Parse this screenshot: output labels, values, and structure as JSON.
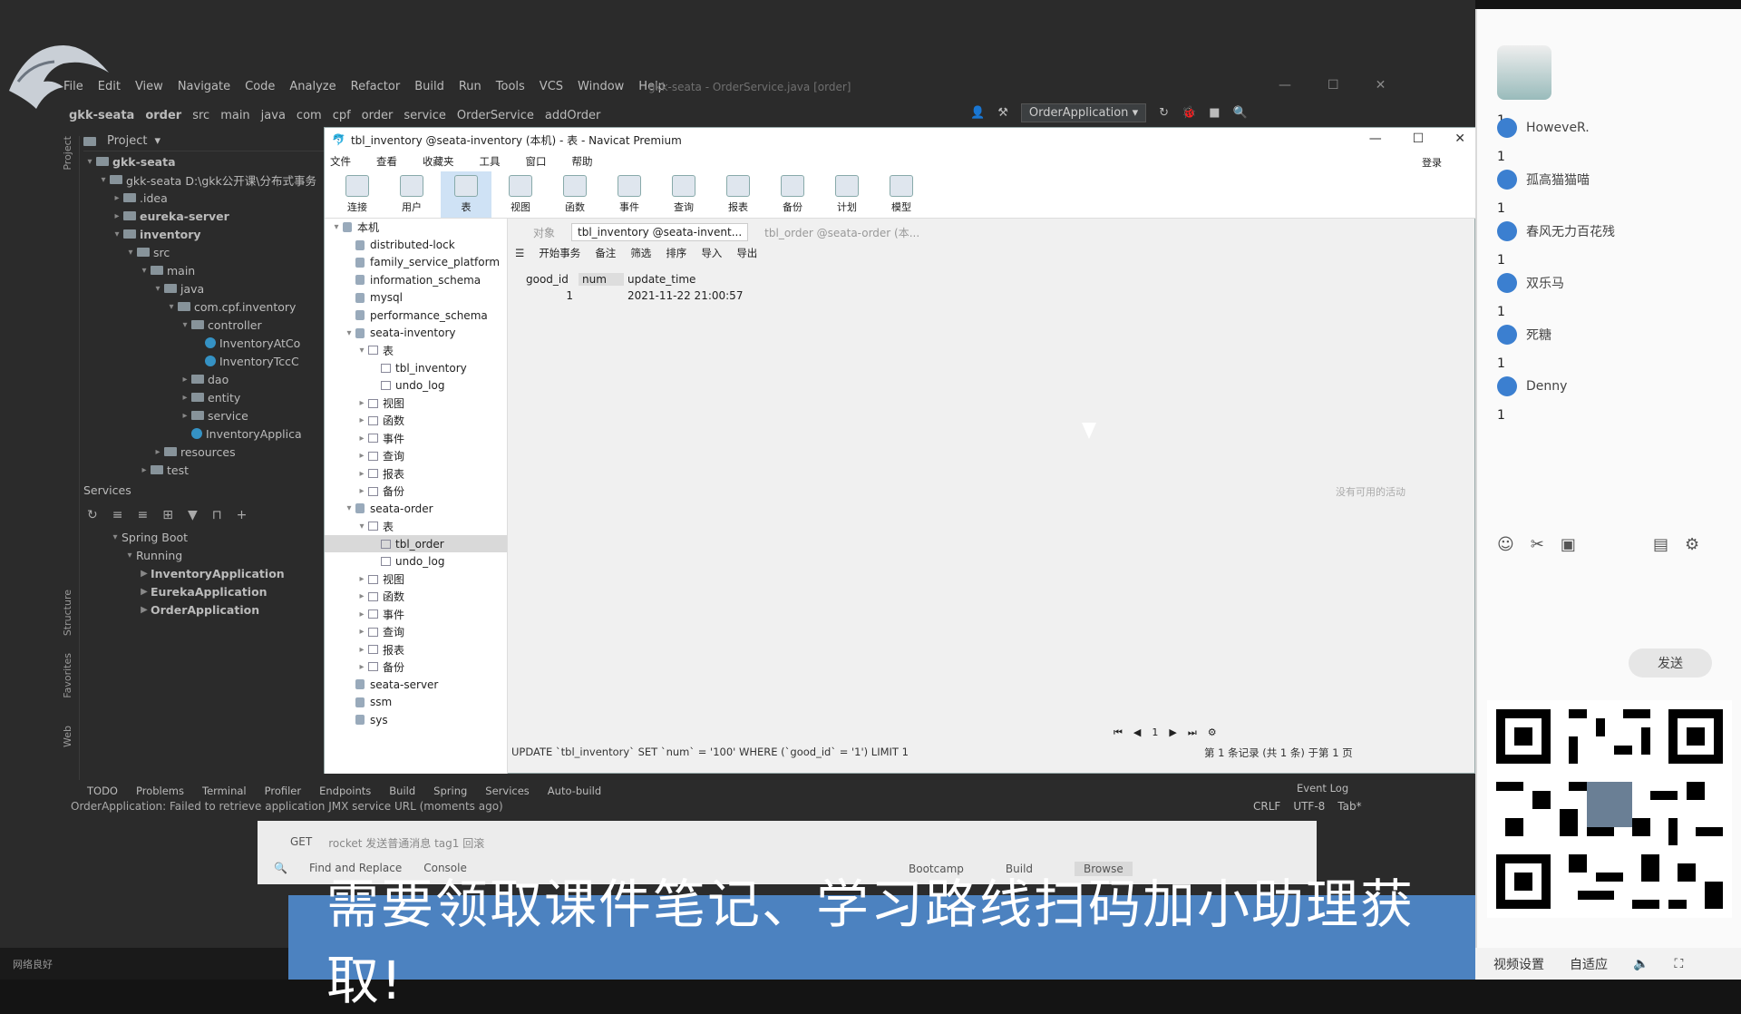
{
  "ide": {
    "menu": [
      "File",
      "Edit",
      "View",
      "Navigate",
      "Code",
      "Analyze",
      "Refactor",
      "Build",
      "Run",
      "Tools",
      "VCS",
      "Window",
      "Help"
    ],
    "title": "gkk-seata - OrderService.java [order]",
    "breadcrumb": [
      "gkk-seata",
      "order",
      "src",
      "main",
      "java",
      "com",
      "cpf",
      "order",
      "service",
      "OrderService",
      "addOrder"
    ],
    "run_config": "OrderApplication",
    "project_label": "Project",
    "tree": [
      {
        "label": "gkk-seata",
        "depth": 0,
        "arrow": "v",
        "bold": true
      },
      {
        "label": "gkk-seata D:\\gkk公开课\\分布式事务",
        "depth": 1,
        "arrow": "v"
      },
      {
        "label": ".idea",
        "depth": 2,
        "arrow": ">"
      },
      {
        "label": "eureka-server",
        "depth": 2,
        "arrow": ">",
        "bold": true
      },
      {
        "label": "inventory",
        "depth": 2,
        "arrow": "v",
        "bold": true
      },
      {
        "label": "src",
        "depth": 3,
        "arrow": "v"
      },
      {
        "label": "main",
        "depth": 4,
        "arrow": "v"
      },
      {
        "label": "java",
        "depth": 5,
        "arrow": "v"
      },
      {
        "label": "com.cpf.inventory",
        "depth": 6,
        "arrow": "v"
      },
      {
        "label": "controller",
        "depth": 7,
        "arrow": "v"
      },
      {
        "label": "InventoryAtCo",
        "depth": 8,
        "arrow": "",
        "cls": true
      },
      {
        "label": "InventoryTccC",
        "depth": 8,
        "arrow": "",
        "cls": true
      },
      {
        "label": "dao",
        "depth": 7,
        "arrow": ">"
      },
      {
        "label": "entity",
        "depth": 7,
        "arrow": ">"
      },
      {
        "label": "service",
        "depth": 7,
        "arrow": ">"
      },
      {
        "label": "InventoryApplica",
        "depth": 7,
        "arrow": "",
        "cls": true
      },
      {
        "label": "resources",
        "depth": 5,
        "arrow": ">"
      },
      {
        "label": "test",
        "depth": 4,
        "arrow": ">"
      }
    ],
    "services_label": "Services",
    "services_tree": [
      {
        "label": "Spring Boot",
        "depth": 0
      },
      {
        "label": "Running",
        "depth": 1
      },
      {
        "label": "InventoryApplication",
        "depth": 2,
        "bold": true
      },
      {
        "label": "EurekaApplication",
        "depth": 2,
        "bold": true
      },
      {
        "label": "OrderApplication",
        "depth": 2,
        "bold": true
      }
    ],
    "left_tabs": [
      "Project",
      "Structure",
      "Favorites",
      "Web"
    ],
    "bottom_tabs": [
      "TODO",
      "Problems",
      "Terminal",
      "Profiler",
      "Endpoints",
      "Build",
      "Spring",
      "Services",
      "Auto-build"
    ],
    "event_log": "Event Log",
    "status_message": "OrderApplication: Failed to retrieve application JMX service URL (moments ago)",
    "status_right": [
      "CRLF",
      "UTF-8",
      "Tab*"
    ],
    "findbar": {
      "hint_method": "GET",
      "hint_text": "rocket 发送普通消息 tag1 回滚",
      "find_replace": "Find and Replace",
      "console": "Console",
      "bootcamp": "Bootcamp",
      "build": "Build",
      "browse": "Browse"
    }
  },
  "navicat": {
    "title": "tbl_inventory @seata-inventory (本机) - 表 - Navicat Premium",
    "menu": [
      "文件",
      "查看",
      "收藏夹",
      "工具",
      "窗口",
      "帮助"
    ],
    "login": "登录",
    "toolbar": [
      "连接",
      "用户",
      "表",
      "视图",
      "函数",
      "事件",
      "查询",
      "报表",
      "备份",
      "计划",
      "模型"
    ],
    "nav": [
      {
        "label": "本机",
        "depth": 0,
        "arrow": "v",
        "type": "conn"
      },
      {
        "label": "distributed-lock",
        "depth": 1,
        "type": "db"
      },
      {
        "label": "family_service_platform",
        "depth": 1,
        "type": "db"
      },
      {
        "label": "information_schema",
        "depth": 1,
        "type": "db"
      },
      {
        "label": "mysql",
        "depth": 1,
        "type": "db"
      },
      {
        "label": "performance_schema",
        "depth": 1,
        "type": "db"
      },
      {
        "label": "seata-inventory",
        "depth": 1,
        "arrow": "v",
        "type": "db"
      },
      {
        "label": "表",
        "depth": 2,
        "arrow": "v",
        "type": "ic"
      },
      {
        "label": "tbl_inventory",
        "depth": 3,
        "type": "ic"
      },
      {
        "label": "undo_log",
        "depth": 3,
        "type": "ic"
      },
      {
        "label": "视图",
        "depth": 2,
        "arrow": ">",
        "type": "ic"
      },
      {
        "label": "函数",
        "depth": 2,
        "arrow": ">",
        "type": "ic"
      },
      {
        "label": "事件",
        "depth": 2,
        "arrow": ">",
        "type": "ic"
      },
      {
        "label": "查询",
        "depth": 2,
        "arrow": ">",
        "type": "ic"
      },
      {
        "label": "报表",
        "depth": 2,
        "arrow": ">",
        "type": "ic"
      },
      {
        "label": "备份",
        "depth": 2,
        "arrow": ">",
        "type": "ic"
      },
      {
        "label": "seata-order",
        "depth": 1,
        "arrow": "v",
        "type": "db"
      },
      {
        "label": "表",
        "depth": 2,
        "arrow": "v",
        "type": "ic"
      },
      {
        "label": "tbl_order",
        "depth": 3,
        "type": "ic",
        "selected": true
      },
      {
        "label": "undo_log",
        "depth": 3,
        "type": "ic"
      },
      {
        "label": "视图",
        "depth": 2,
        "arrow": ">",
        "type": "ic"
      },
      {
        "label": "函数",
        "depth": 2,
        "arrow": ">",
        "type": "ic"
      },
      {
        "label": "事件",
        "depth": 2,
        "arrow": ">",
        "type": "ic"
      },
      {
        "label": "查询",
        "depth": 2,
        "arrow": ">",
        "type": "ic"
      },
      {
        "label": "报表",
        "depth": 2,
        "arrow": ">",
        "type": "ic"
      },
      {
        "label": "备份",
        "depth": 2,
        "arrow": ">",
        "type": "ic"
      },
      {
        "label": "seata-server",
        "depth": 1,
        "type": "db"
      },
      {
        "label": "ssm",
        "depth": 1,
        "type": "db"
      },
      {
        "label": "sys",
        "depth": 1,
        "type": "db"
      }
    ],
    "tabs": {
      "objects": "对象",
      "active": "tbl_inventory @seata-invent...",
      "other": "tbl_order @seata-order (本..."
    },
    "grid_tools": [
      "开始事务",
      "备注",
      "筛选",
      "排序",
      "导入",
      "导出"
    ],
    "columns": [
      "good_id",
      "num",
      "update_time"
    ],
    "rows": [
      [
        "1",
        "",
        "2021-11-22 21:00:57"
      ]
    ],
    "empty_hint": "没有可用的活动",
    "sql": "UPDATE `tbl_inventory` SET `num` = '100' WHERE (`good_id` = '1') LIMIT 1",
    "page_number": "1",
    "records": "第 1 条记录 (共 1 条) 于第 1 页"
  },
  "chat": {
    "users": [
      {
        "name": "",
        "count": "1"
      },
      {
        "name": "HoweveR.",
        "count": "1"
      },
      {
        "name": "孤高猫猫喵",
        "count": "1"
      },
      {
        "name": "春风无力百花残",
        "count": "1"
      },
      {
        "name": "双乐马",
        "count": "1"
      },
      {
        "name": "死糖",
        "count": "1"
      },
      {
        "name": "Denny",
        "count": "1"
      }
    ],
    "send_label": "发送"
  },
  "banner_text": "需要领取课件笔记、学习路线扫码加小助理获取!",
  "bottom_right": [
    "视频设置",
    "自适应"
  ],
  "bottom_left": "网络良好"
}
